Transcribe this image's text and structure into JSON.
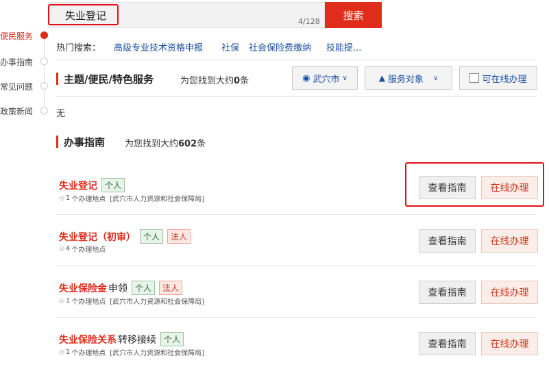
{
  "search": {
    "value": "失业登记",
    "char_count": "4/128",
    "button_label": "搜索"
  },
  "nav": {
    "items": [
      {
        "label": "便民服务",
        "active": true
      },
      {
        "label": "办事指南",
        "active": false
      },
      {
        "label": "常见问题",
        "active": false
      },
      {
        "label": "政策新闻",
        "active": false
      }
    ]
  },
  "hot_search": {
    "label": "热门搜索：",
    "links": [
      "高级专业技术资格申报",
      "社保",
      "社会保险费缴纳",
      "技能提..."
    ]
  },
  "section_theme": {
    "title": "主题/便民/特色服务",
    "count_prefix": "为您找到大约",
    "count": "0",
    "count_suffix": "条",
    "filter_city": "武穴市",
    "filter_target": "服务对象",
    "filter_online": "可在线办理",
    "empty_text": "无"
  },
  "section_guide": {
    "title": "办事指南",
    "count_prefix": "为您找到大约",
    "count": "602",
    "count_suffix": "条"
  },
  "items": [
    {
      "title_red": "失业登记",
      "title_rest": "",
      "tags": [
        "个人"
      ],
      "sub_count": "1",
      "sub_text": "个办理地点",
      "sub_org": "[武穴市人力资源和社会保障局]",
      "btn_guide": "查看指南",
      "btn_online": "在线办理"
    },
    {
      "title_red": "失业登记（初审）",
      "title_rest": "",
      "tags": [
        "个人",
        "法人"
      ],
      "sub_count": "4",
      "sub_text": "个办理地点",
      "sub_org": "",
      "btn_guide": "查看指南",
      "btn_online": "在线办理"
    },
    {
      "title_red": "失业保险金",
      "title_rest": "申领",
      "tags": [
        "个人",
        "法人"
      ],
      "sub_count": "1",
      "sub_text": "个办理地点",
      "sub_org": "[武穴市人力资源和社会保障局]",
      "btn_guide": "查看指南",
      "btn_online": "在线办理"
    },
    {
      "title_red": "失业保险关系",
      "title_rest": "转移接续",
      "tags": [
        "个人"
      ],
      "sub_count": "1",
      "sub_text": "个办理地点",
      "sub_org": "[武穴市人力资源和社会保障局]",
      "btn_guide": "查看指南",
      "btn_online": "在线办理"
    }
  ],
  "colors": {
    "accent": "#e02d1b",
    "link": "#1a4ea3",
    "highlight_box": "#e0101a"
  }
}
